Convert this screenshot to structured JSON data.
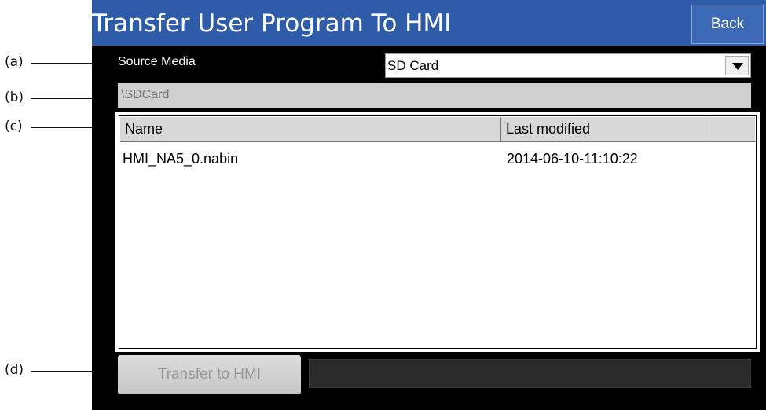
{
  "annotations": [
    "(a)",
    "(b)",
    "(c)",
    "(d)"
  ],
  "header": {
    "title": "Transfer User Program To HMI",
    "back_label": "Back"
  },
  "source": {
    "label": "Source Media",
    "selected": "SD Card"
  },
  "path": "\\SDCard",
  "files": {
    "columns": [
      "Name",
      "Last modified"
    ],
    "rows": [
      {
        "name": "HMI_NA5_0.nabin",
        "modified": "2014-06-10-11:10:22"
      }
    ]
  },
  "transfer_label": "Transfer to HMI",
  "colors": {
    "title_bar": "#2e5ca8",
    "screen_bg": "#000000"
  }
}
